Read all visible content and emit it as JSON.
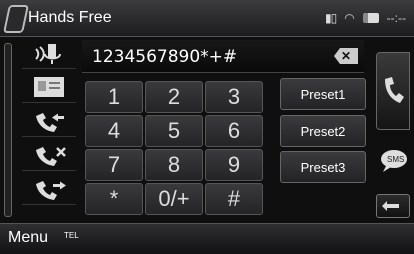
{
  "header": {
    "title": "Hands Free",
    "signal": "▮▯",
    "time": "--:--"
  },
  "display": {
    "number": "1234567890*+#"
  },
  "keys": [
    "1",
    "2",
    "3",
    "4",
    "5",
    "6",
    "7",
    "8",
    "9",
    "*",
    "0/+",
    "#"
  ],
  "presets": [
    "Preset1",
    "Preset2",
    "Preset3"
  ],
  "footer": {
    "menu": "Menu",
    "tel": "TEL"
  },
  "icons": {
    "sidebar": [
      "voice-dial-icon",
      "phonebook-icon",
      "incoming-call-icon",
      "missed-call-icon",
      "outgoing-call-icon"
    ],
    "right": [
      "call-icon",
      "sms-icon",
      "back-icon"
    ]
  },
  "colors": {
    "accent": "#ffffff",
    "panel": "#2f2f31",
    "background": "#0f0f10"
  }
}
